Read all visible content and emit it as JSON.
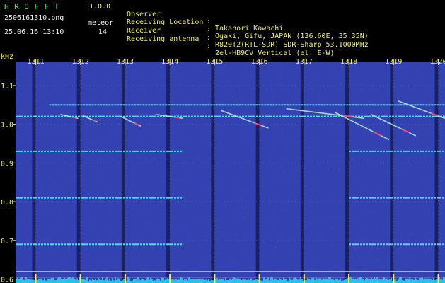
{
  "header": {
    "app_name": "HROFFT",
    "app_version": "1.0.0",
    "file_name": "2506161310.png",
    "datetime": "25.06.16 13:10",
    "mode_label": "meteor",
    "count": "14"
  },
  "station_info": [
    {
      "key": "Observer",
      "sep": ":",
      "value": "Takanori Kawachi"
    },
    {
      "key": "Receiving Location",
      "sep": ":",
      "value": "Ogaki, Gifu, JAPAN (136.60E, 35.35N)"
    },
    {
      "key": "Receiver",
      "sep": ":",
      "value": "R820T2(RTL-SDR) SDR-Sharp 53.1000MHz"
    },
    {
      "key": "Receiving antenna",
      "sep": ":",
      "value": "2el-HB9CV Vertical (el. E-W)"
    }
  ],
  "colors": {
    "background": "#000000",
    "header_green": "#2ee86a",
    "header_yellow": "#f2f24a",
    "noise_floor": "#0f1560",
    "carrier_line": "#56e6ff",
    "meteor_trace": "#b8f0d8",
    "meteor_head": "#ff3a7a",
    "level_bar": "#2ad6f0"
  },
  "chart_data": {
    "type": "heatmap",
    "y_unit_label": "kHz",
    "ylim": [
      0.59,
      1.16
    ],
    "y_ticks": [
      "1.1",
      "1.0",
      "0.9",
      "0.8",
      "0.7",
      "0.6"
    ],
    "y_tick_values": [
      1.1,
      1.0,
      0.9,
      0.8,
      0.7,
      0.6
    ],
    "xlim": [
      1310.55,
      1320.15
    ],
    "x_ticks": [
      "1311",
      "1312",
      "1313",
      "1314",
      "1315",
      "1316",
      "1317",
      "1318",
      "1319",
      "1320"
    ],
    "x_tick_values": [
      1311,
      1312,
      1313,
      1314,
      1315,
      1316,
      1317,
      1318,
      1319,
      1320
    ],
    "grid": "dotted",
    "carriers": [
      {
        "freq": 1.05,
        "from": 1311.3,
        "to": 1320.15
      },
      {
        "freq": 1.02,
        "from": 1310.55,
        "to": 1320.15
      },
      {
        "freq": 0.93,
        "from": 1310.55,
        "to": 1314.3
      },
      {
        "freq": 0.93,
        "from": 1318.0,
        "to": 1320.15
      },
      {
        "freq": 0.81,
        "from": 1310.55,
        "to": 1314.3
      },
      {
        "freq": 0.81,
        "from": 1318.0,
        "to": 1320.15
      },
      {
        "freq": 0.69,
        "from": 1310.55,
        "to": 1314.3
      },
      {
        "freq": 0.69,
        "from": 1318.0,
        "to": 1320.15
      },
      {
        "freq": 0.62,
        "from": 1310.55,
        "to": 1320.15
      },
      {
        "freq": 0.605,
        "from": 1310.55,
        "to": 1320.15
      }
    ],
    "meteors": [
      {
        "x": [
          1311.55,
          1311.95
        ],
        "y": [
          1.025,
          1.015
        ]
      },
      {
        "x": [
          1312.05,
          1312.4
        ],
        "y": [
          1.022,
          1.005
        ]
      },
      {
        "x": [
          1312.9,
          1313.35
        ],
        "y": [
          1.02,
          0.995
        ]
      },
      {
        "x": [
          1313.7,
          1314.3
        ],
        "y": [
          1.025,
          1.015
        ]
      },
      {
        "x": [
          1315.15,
          1316.2
        ],
        "y": [
          1.035,
          0.99
        ]
      },
      {
        "x": [
          1316.6,
          1318.35
        ],
        "y": [
          1.04,
          1.015
        ]
      },
      {
        "x": [
          1317.7,
          1318.9
        ],
        "y": [
          1.03,
          0.96
        ]
      },
      {
        "x": [
          1318.5,
          1319.5
        ],
        "y": [
          1.025,
          0.97
        ]
      },
      {
        "x": [
          1319.1,
          1320.15
        ],
        "y": [
          1.06,
          1.015
        ]
      }
    ]
  }
}
